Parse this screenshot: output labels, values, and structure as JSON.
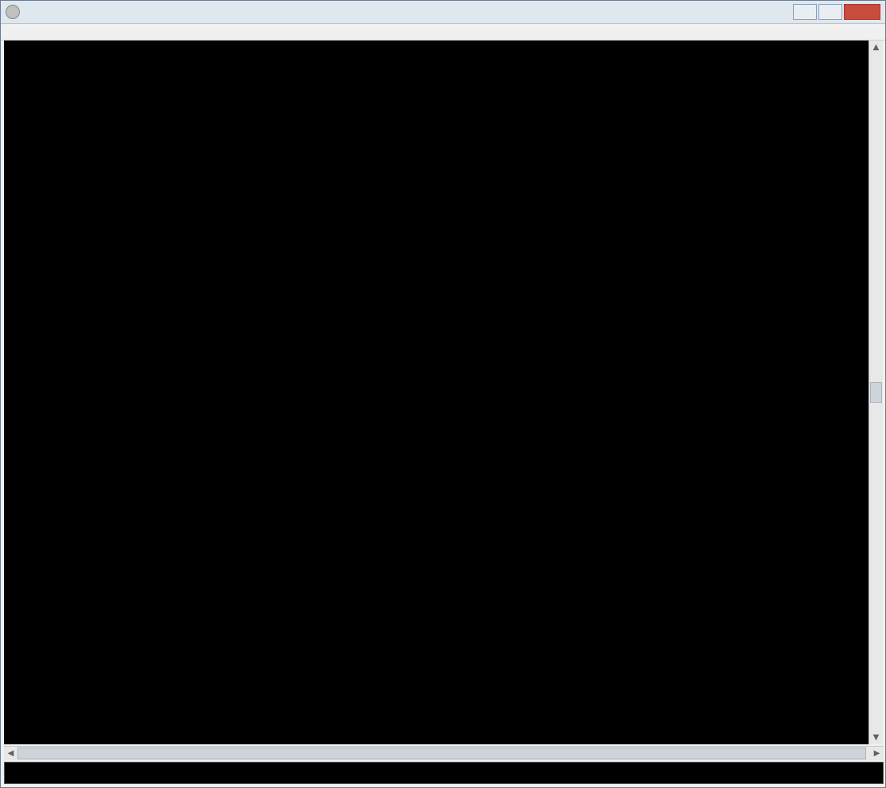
{
  "window": {
    "title": "",
    "buttons": {
      "minimize": "",
      "maximize": "",
      "close": ""
    }
  },
  "menu": {
    "items": []
  },
  "terminal": {
    "lines": []
  },
  "command": {
    "value": ""
  }
}
